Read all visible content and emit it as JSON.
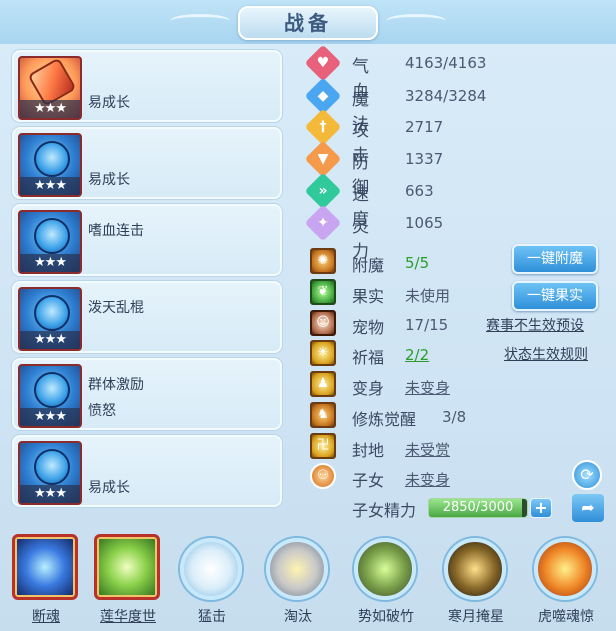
{
  "title": "战备",
  "pets": [
    {
      "stars": "★★★",
      "line1": "",
      "line2": "易成长",
      "icon": "popsicle-icon"
    },
    {
      "stars": "★★★",
      "line1": "",
      "line2": "易成长",
      "icon": "blue-warrior-icon"
    },
    {
      "stars": "★★★",
      "line1": "嗜血连击",
      "line2": "",
      "icon": "blue-warrior-icon"
    },
    {
      "stars": "★★★",
      "line1": "泼天乱棍",
      "line2": "",
      "icon": "blue-warrior-icon"
    },
    {
      "stars": "★★★",
      "line1": "群体激励",
      "line2": "愤怒",
      "icon": "blue-warrior-icon"
    },
    {
      "stars": "★★★",
      "line1": "",
      "line2": "易成长",
      "icon": "blue-warrior-icon"
    }
  ],
  "stats": [
    {
      "label": "气血",
      "value": "4163/4163",
      "color": "#e8607a",
      "glyph": "♥"
    },
    {
      "label": "魔法",
      "value": "3284/3284",
      "color": "#4aa6f0",
      "glyph": "◆"
    },
    {
      "label": "攻击",
      "value": "2717",
      "color": "#f5b93a",
      "glyph": "†"
    },
    {
      "label": "防御",
      "value": "1337",
      "color": "#f59a4a",
      "glyph": "▼"
    },
    {
      "label": "速度",
      "value": "663",
      "color": "#2fc99a",
      "glyph": "»"
    },
    {
      "label": "灵力",
      "value": "1065",
      "color": "#c9a4f0",
      "glyph": "✦"
    }
  ],
  "extras": {
    "enchant_label": "附魔",
    "enchant_value": "5/5",
    "fruit_label": "果实",
    "fruit_value": "未使用",
    "pet_label": "宠物",
    "pet_value": "17/15",
    "bless_label": "祈福",
    "bless_value": "2/2",
    "transform_label": "变身",
    "transform_value": "未变身",
    "train_label": "修炼觉醒",
    "train_value": "3/8",
    "land_label": "封地",
    "land_value": "未受赏",
    "child_label": "子女",
    "child_value": "未变身",
    "child_energy_label": "子女精力",
    "child_energy_value": "2850/3000",
    "child_energy_ratio": 0.95
  },
  "buttons": {
    "enchant": "一键附魔",
    "fruit": "一键果实",
    "event_preset": "赛事不生效预设",
    "status_rules": "状态生效规则",
    "plus": "+",
    "refresh": "⟳",
    "share": "➦"
  },
  "skills": [
    {
      "name": "断魂",
      "kind": "square",
      "underline": true,
      "color1": "#b7f0ff",
      "color2": "#1a4aa8"
    },
    {
      "name": "莲华度世",
      "kind": "square",
      "underline": true,
      "color1": "#e8ffb0",
      "color2": "#3a9a2a"
    },
    {
      "name": "猛击",
      "kind": "round",
      "underline": false,
      "color1": "#ffffff",
      "color2": "#5fb0e8"
    },
    {
      "name": "淘汰",
      "kind": "round",
      "underline": false,
      "color1": "#fff3b0",
      "color2": "#8a8a8a"
    },
    {
      "name": "势如破竹",
      "kind": "round",
      "underline": false,
      "color1": "#d8ff9a",
      "color2": "#4a7a2a"
    },
    {
      "name": "寒月掩星",
      "kind": "round",
      "underline": false,
      "color1": "#ffe08a",
      "color2": "#2a1a0a"
    },
    {
      "name": "虎噬魂惊",
      "kind": "round",
      "underline": false,
      "color1": "#fff08a",
      "color2": "#e05a10"
    }
  ]
}
